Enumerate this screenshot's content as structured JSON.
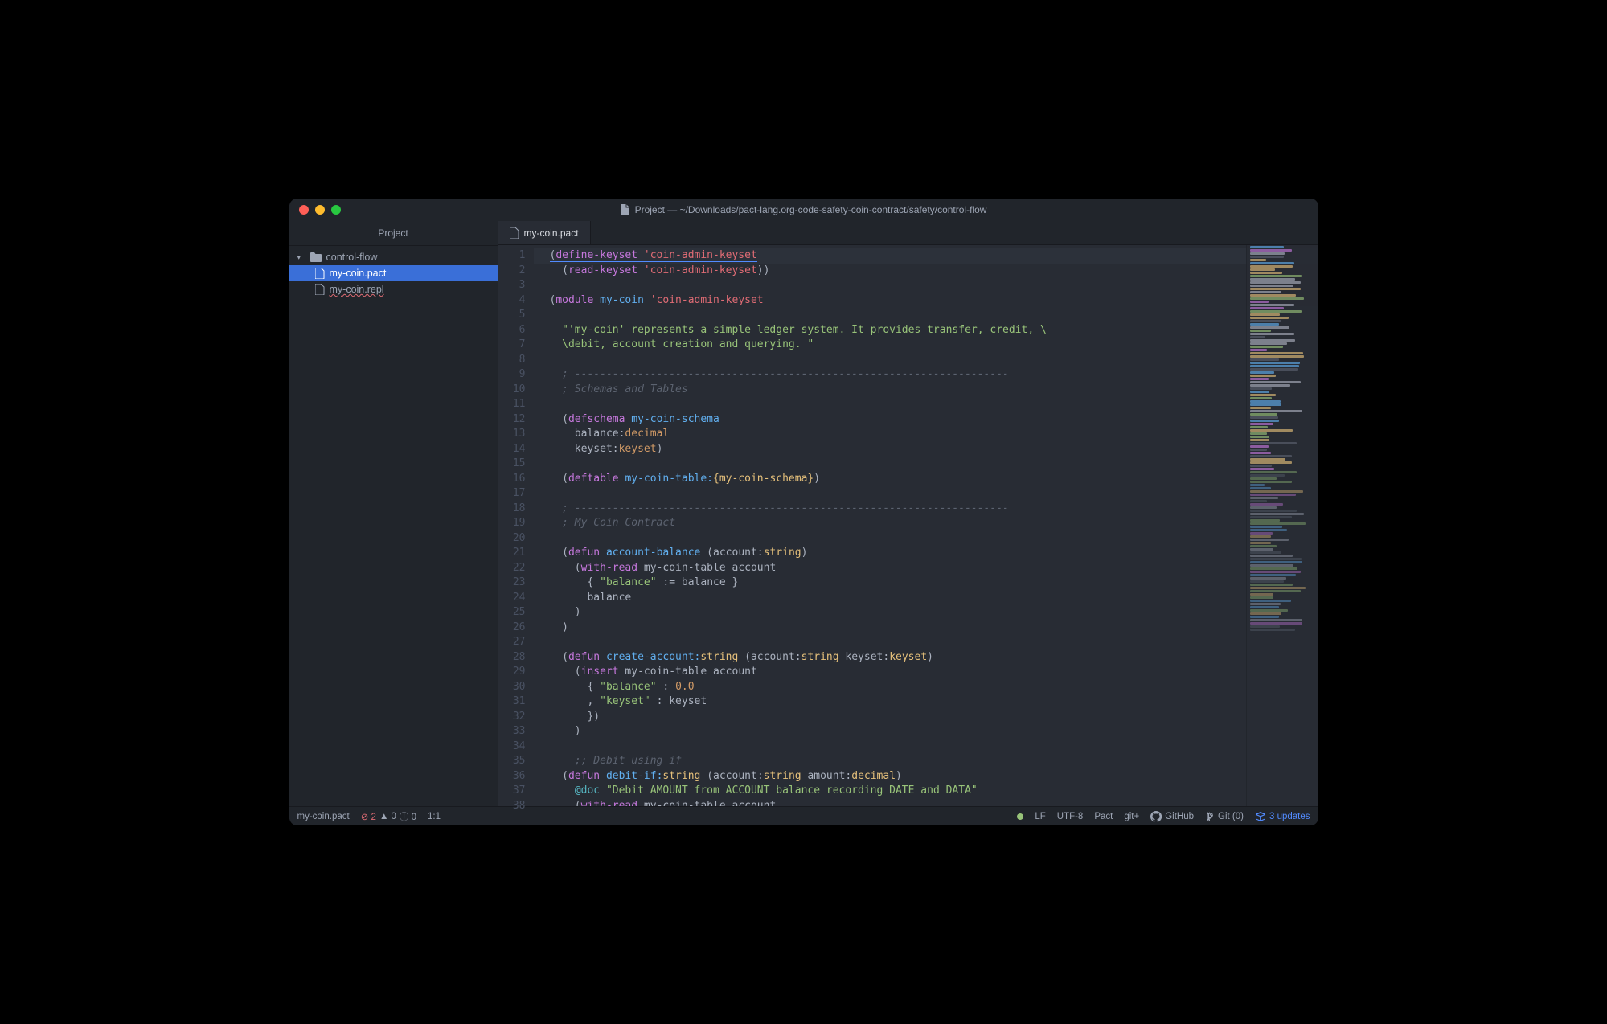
{
  "window": {
    "title": "Project — ~/Downloads/pact-lang.org-code-safety-coin-contract/safety/control-flow"
  },
  "sidebar": {
    "header": "Project",
    "root": {
      "name": "control-flow",
      "expanded": true
    },
    "files": [
      {
        "name": "my-coin.pact",
        "active": true,
        "wavy": false
      },
      {
        "name": "my-coin.repl",
        "active": false,
        "wavy": true
      }
    ]
  },
  "tabs": [
    {
      "label": "my-coin.pact",
      "active": true
    }
  ],
  "code_lines": [
    {
      "n": 1,
      "tokens": [
        [
          "(",
          "paren"
        ],
        [
          "define-keyset",
          "kw"
        ],
        [
          " ",
          "p"
        ],
        [
          "'coin-admin-keyset",
          "sym"
        ]
      ],
      "hl": true
    },
    {
      "n": 2,
      "tokens": [
        [
          "  (",
          "paren"
        ],
        [
          "read-keyset",
          "kw"
        ],
        [
          " ",
          "p"
        ],
        [
          "'coin-admin-keyset",
          "sym"
        ],
        [
          ")",
          "paren"
        ],
        [
          ")",
          "paren"
        ]
      ]
    },
    {
      "n": 3,
      "tokens": []
    },
    {
      "n": 4,
      "tokens": [
        [
          "(",
          "paren"
        ],
        [
          "module",
          "kw"
        ],
        [
          " ",
          "p"
        ],
        [
          "my-coin",
          "fn"
        ],
        [
          " ",
          "p"
        ],
        [
          "'coin-admin-keyset",
          "sym"
        ]
      ]
    },
    {
      "n": 5,
      "tokens": []
    },
    {
      "n": 6,
      "tokens": [
        [
          "  ",
          "p"
        ],
        [
          "\"'my-coin' represents a simple ledger system. It provides transfer, credit, \\",
          "str"
        ]
      ]
    },
    {
      "n": 7,
      "tokens": [
        [
          "  ",
          "p"
        ],
        [
          "\\debit, account creation and querying. \"",
          "str"
        ]
      ]
    },
    {
      "n": 8,
      "tokens": []
    },
    {
      "n": 9,
      "tokens": [
        [
          "  ",
          "p"
        ],
        [
          "; ---------------------------------------------------------------------",
          "cmt"
        ]
      ]
    },
    {
      "n": 10,
      "tokens": [
        [
          "  ",
          "p"
        ],
        [
          "; Schemas and Tables",
          "cmt"
        ]
      ]
    },
    {
      "n": 11,
      "tokens": []
    },
    {
      "n": 12,
      "tokens": [
        [
          "  (",
          "paren"
        ],
        [
          "defschema",
          "kw"
        ],
        [
          " ",
          "p"
        ],
        [
          "my-coin-schema",
          "fn"
        ]
      ]
    },
    {
      "n": 13,
      "tokens": [
        [
          "    balance:",
          "p"
        ],
        [
          "decimal",
          "attr"
        ]
      ]
    },
    {
      "n": 14,
      "tokens": [
        [
          "    keyset:",
          "p"
        ],
        [
          "keyset",
          "attr"
        ],
        [
          ")",
          "paren"
        ]
      ]
    },
    {
      "n": 15,
      "tokens": []
    },
    {
      "n": 16,
      "tokens": [
        [
          "  (",
          "paren"
        ],
        [
          "deftable",
          "kw"
        ],
        [
          " ",
          "p"
        ],
        [
          "my-coin-table:",
          "fn"
        ],
        [
          "{",
          "type"
        ],
        [
          "my-coin-schema",
          "type"
        ],
        [
          "}",
          "type"
        ],
        [
          ")",
          "paren"
        ]
      ]
    },
    {
      "n": 17,
      "tokens": []
    },
    {
      "n": 18,
      "tokens": [
        [
          "  ",
          "p"
        ],
        [
          "; ---------------------------------------------------------------------",
          "cmt"
        ]
      ]
    },
    {
      "n": 19,
      "tokens": [
        [
          "  ",
          "p"
        ],
        [
          "; My Coin Contract",
          "cmt"
        ]
      ]
    },
    {
      "n": 20,
      "tokens": []
    },
    {
      "n": 21,
      "tokens": [
        [
          "  (",
          "paren"
        ],
        [
          "defun",
          "kw"
        ],
        [
          " ",
          "p"
        ],
        [
          "account-balance",
          "fn"
        ],
        [
          " (",
          "paren"
        ],
        [
          "account:",
          "p"
        ],
        [
          "string",
          "type"
        ],
        [
          ")",
          "paren"
        ]
      ]
    },
    {
      "n": 22,
      "tokens": [
        [
          "    (",
          "paren"
        ],
        [
          "with-read",
          "kw"
        ],
        [
          " my-coin-table account",
          "p"
        ]
      ]
    },
    {
      "n": 23,
      "tokens": [
        [
          "      { ",
          "p"
        ],
        [
          "\"balance\"",
          "str"
        ],
        [
          " := balance }",
          "p"
        ]
      ]
    },
    {
      "n": 24,
      "tokens": [
        [
          "      balance",
          "p"
        ]
      ]
    },
    {
      "n": 25,
      "tokens": [
        [
          "    )",
          "paren"
        ]
      ]
    },
    {
      "n": 26,
      "tokens": [
        [
          "  )",
          "paren"
        ]
      ]
    },
    {
      "n": 27,
      "tokens": []
    },
    {
      "n": 28,
      "tokens": [
        [
          "  (",
          "paren"
        ],
        [
          "defun",
          "kw"
        ],
        [
          " ",
          "p"
        ],
        [
          "create-account:",
          "fn"
        ],
        [
          "string",
          "type"
        ],
        [
          " (",
          "paren"
        ],
        [
          "account:",
          "p"
        ],
        [
          "string",
          "type"
        ],
        [
          " keyset:",
          "p"
        ],
        [
          "keyset",
          "type"
        ],
        [
          ")",
          "paren"
        ]
      ]
    },
    {
      "n": 29,
      "tokens": [
        [
          "    (",
          "paren"
        ],
        [
          "insert",
          "kw"
        ],
        [
          " my-coin-table account",
          "p"
        ]
      ]
    },
    {
      "n": 30,
      "tokens": [
        [
          "      { ",
          "p"
        ],
        [
          "\"balance\"",
          "str"
        ],
        [
          " : ",
          "p"
        ],
        [
          "0.0",
          "num"
        ]
      ]
    },
    {
      "n": 31,
      "tokens": [
        [
          "      , ",
          "p"
        ],
        [
          "\"keyset\"",
          "str"
        ],
        [
          " : keyset",
          "p"
        ]
      ]
    },
    {
      "n": 32,
      "tokens": [
        [
          "      })",
          "paren"
        ]
      ]
    },
    {
      "n": 33,
      "tokens": [
        [
          "    )",
          "paren"
        ]
      ]
    },
    {
      "n": 34,
      "tokens": []
    },
    {
      "n": 35,
      "tokens": [
        [
          "    ",
          "p"
        ],
        [
          ";; Debit using if",
          "cmt"
        ]
      ]
    },
    {
      "n": 36,
      "tokens": [
        [
          "  (",
          "paren"
        ],
        [
          "defun",
          "kw"
        ],
        [
          " ",
          "p"
        ],
        [
          "debit-if:",
          "fn"
        ],
        [
          "string",
          "type"
        ],
        [
          " (",
          "paren"
        ],
        [
          "account:",
          "p"
        ],
        [
          "string",
          "type"
        ],
        [
          " amount:",
          "p"
        ],
        [
          "decimal",
          "type"
        ],
        [
          ")",
          "paren"
        ]
      ]
    },
    {
      "n": 37,
      "tokens": [
        [
          "    ",
          "p"
        ],
        [
          "@doc",
          "at"
        ],
        [
          " ",
          "p"
        ],
        [
          "\"Debit AMOUNT from ACCOUNT balance recording DATE and DATA\"",
          "str"
        ]
      ]
    },
    {
      "n": 38,
      "tokens": [
        [
          "    (",
          "paren"
        ],
        [
          "with-read",
          "kw"
        ],
        [
          " my-coin-table account",
          "p"
        ]
      ]
    }
  ],
  "status": {
    "filename": "my-coin.pact",
    "errors": "2",
    "warnings": "0",
    "info": "0",
    "cursor": "1:1",
    "line_ending": "LF",
    "encoding": "UTF-8",
    "language": "Pact",
    "git_status": "git+",
    "github": "GitHub",
    "git_branch": "Git (0)",
    "updates": "3 updates"
  }
}
